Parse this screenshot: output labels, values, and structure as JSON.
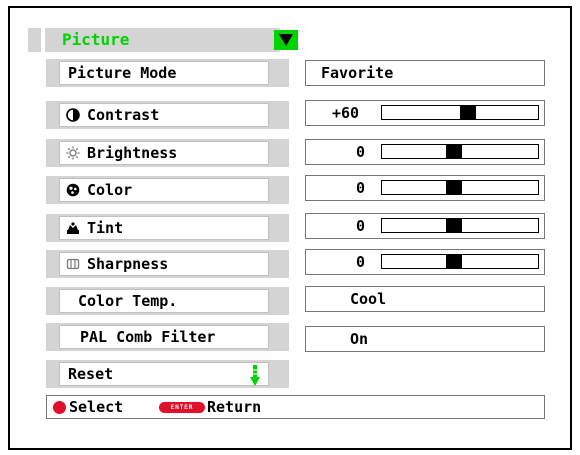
{
  "menu": {
    "title": "Picture",
    "items": [
      {
        "label": "Picture Mode",
        "value": "Favorite",
        "icon": "none"
      },
      {
        "label": "Contrast",
        "value": "+60",
        "icon": "contrast-icon",
        "slider": 0.6
      },
      {
        "label": "Brightness",
        "value": "0",
        "icon": "brightness-icon",
        "slider": 0.5
      },
      {
        "label": "Color",
        "value": "0",
        "icon": "color-icon",
        "slider": 0.5
      },
      {
        "label": "Tint",
        "value": "0",
        "icon": "tint-icon",
        "slider": 0.5
      },
      {
        "label": "Sharpness",
        "value": "0",
        "icon": "sharpness-icon",
        "slider": 0.5
      },
      {
        "label": "Color Temp.",
        "value": "Cool",
        "icon": "none"
      },
      {
        "label": "PAL Comb Filter",
        "value": "On",
        "icon": "none"
      },
      {
        "label": "Reset",
        "icon": "none"
      }
    ]
  },
  "footer": {
    "select_label": "Select",
    "enter_badge": "ENTER",
    "return_label": "Return"
  },
  "colors": {
    "accent_green": "#00d400",
    "panel_gray": "#d4d4d4",
    "button_red": "#e0102a"
  }
}
